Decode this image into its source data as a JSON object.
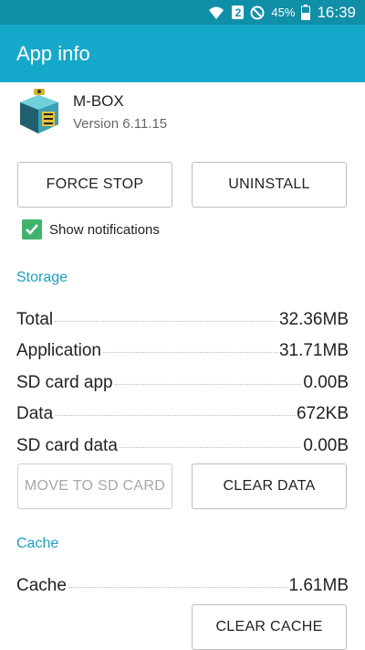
{
  "status_bar": {
    "sim_slot": "2",
    "battery": "45%",
    "time": "16:39",
    "icons": [
      "wifi-icon",
      "sim-icon",
      "do-not-disturb-icon",
      "battery-icon"
    ]
  },
  "app_bar": {
    "title": "App info"
  },
  "app": {
    "name": "M-BOX",
    "version": "Version 6.11.15",
    "icon": "toolbox-app-icon"
  },
  "buttons": {
    "force_stop": "FORCE STOP",
    "uninstall": "UNINSTALL",
    "move_to_sd": "MOVE TO SD CARD",
    "clear_data": "CLEAR DATA",
    "clear_cache": "CLEAR CACHE"
  },
  "notifications": {
    "label": "Show notifications",
    "checked": true
  },
  "storage": {
    "title": "Storage",
    "rows": [
      {
        "label": "Total",
        "value": "32.36MB"
      },
      {
        "label": "Application",
        "value": "31.71MB"
      },
      {
        "label": "SD card app",
        "value": "0.00B"
      },
      {
        "label": "Data",
        "value": "672KB"
      },
      {
        "label": "SD card data",
        "value": "0.00B"
      }
    ]
  },
  "cache": {
    "title": "Cache",
    "rows": [
      {
        "label": "Cache",
        "value": "1.61MB"
      }
    ]
  },
  "colors": {
    "status_bar": "#0f8fa8",
    "app_bar": "#16a8cb",
    "accent": "#1a9fc4",
    "checkbox": "#3fb36c"
  }
}
